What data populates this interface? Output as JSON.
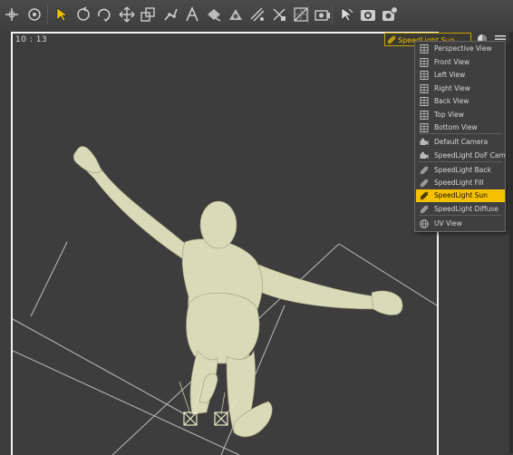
{
  "toolbar": {
    "tools": [
      {
        "name": "universal-tool-icon"
      },
      {
        "name": "node-selection-icon"
      },
      {
        "name": "select-arrow-icon"
      },
      {
        "name": "rotate-view-icon"
      },
      {
        "name": "orbit-icon"
      },
      {
        "name": "translate-icon"
      },
      {
        "name": "scale-icon"
      },
      {
        "name": "joint-editor-icon"
      },
      {
        "name": "node-weight-icon"
      },
      {
        "name": "surface-selection-icon"
      },
      {
        "name": "geometry-editor-icon"
      },
      {
        "name": "transfer-icon"
      },
      {
        "name": "region-navigator-icon"
      },
      {
        "name": "grid-tool-icon"
      },
      {
        "name": "camera-tool-icon"
      },
      {
        "name": "spot-render-icon"
      },
      {
        "name": "render-icon"
      },
      {
        "name": "render-settings-icon"
      }
    ]
  },
  "viewport": {
    "frame_label": "10 : 13",
    "camera_select_value": "SpeedLight Sun",
    "accent_color": "#f5c000"
  },
  "menu": {
    "items": [
      {
        "label": "Perspective View",
        "icon": "view-grid-icon"
      },
      {
        "label": "Front View",
        "icon": "view-grid-icon"
      },
      {
        "label": "Left View",
        "icon": "view-grid-icon"
      },
      {
        "label": "Right View",
        "icon": "view-grid-icon"
      },
      {
        "label": "Back View",
        "icon": "view-grid-icon"
      },
      {
        "label": "Top View",
        "icon": "view-grid-icon"
      },
      {
        "label": "Bottom View",
        "icon": "view-grid-icon"
      },
      {
        "label": "Default Camera",
        "icon": "camera-icon"
      },
      {
        "label": "SpeedLight DoF Cam",
        "icon": "camera-icon"
      },
      {
        "label": "SpeedLight Back",
        "icon": "spotlight-icon"
      },
      {
        "label": "SpeedLight Fill",
        "icon": "spotlight-icon"
      },
      {
        "label": "SpeedLight Sun",
        "icon": "spotlight-icon",
        "selected": true
      },
      {
        "label": "SpeedLight Diffuse",
        "icon": "spotlight-icon"
      },
      {
        "label": "UV View",
        "icon": "globe-icon"
      }
    ]
  }
}
